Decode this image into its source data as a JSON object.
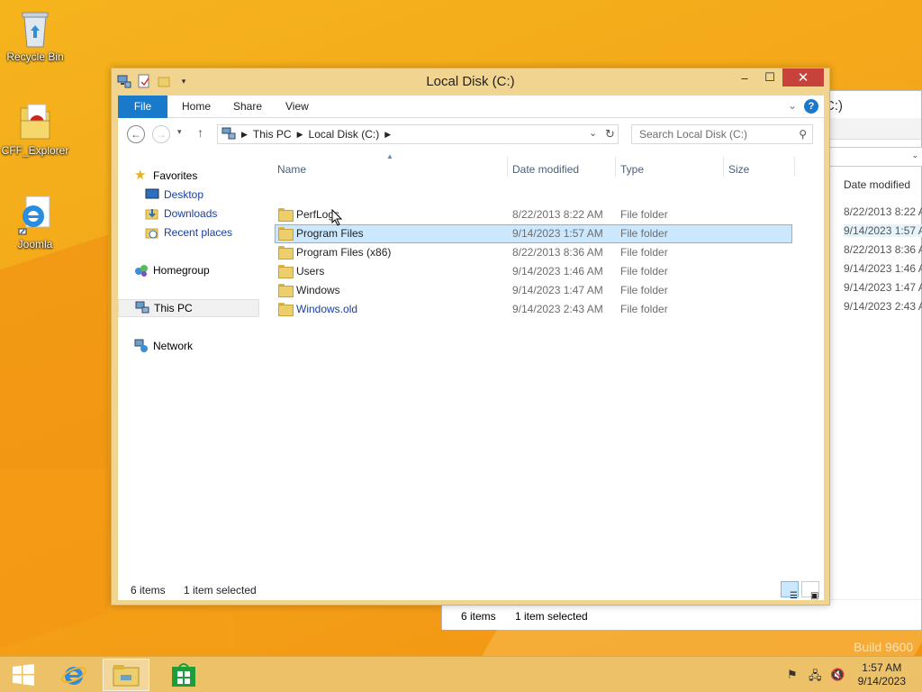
{
  "desktop": {
    "icons": [
      {
        "label": "Recycle Bin",
        "icon": "recycle-bin-icon"
      },
      {
        "label": "CFF_Explorer",
        "icon": "cff-explorer-icon"
      },
      {
        "label": "Joomla",
        "icon": "internet-explorer-icon"
      }
    ],
    "watermark": "Build 9600"
  },
  "background_window": {
    "title_fragment": "C:)",
    "column_header": "Date modified",
    "rows": [
      "8/22/2013 8:22 A",
      "9/14/2023 1:57 A",
      "8/22/2013 8:36 A",
      "9/14/2023 1:46 A",
      "9/14/2023 1:47 A",
      "9/14/2023 2:43 A"
    ],
    "status_count": "6 items",
    "status_selected": "1 item selected"
  },
  "window": {
    "title": "Local Disk (C:)",
    "controls": {
      "minimize": "–",
      "maximize": "☐",
      "close": "✕"
    },
    "ribbon_tabs": {
      "file": "File",
      "home": "Home",
      "share": "Share",
      "view": "View"
    },
    "help": "?",
    "address": {
      "crumb1": "This PC",
      "crumb2": "Local Disk (C:)"
    },
    "search_placeholder": "Search Local Disk (C:)",
    "nav_pane": {
      "favorites": "Favorites",
      "desktop": "Desktop",
      "downloads": "Downloads",
      "recent": "Recent places",
      "homegroup": "Homegroup",
      "this_pc": "This PC",
      "network": "Network"
    },
    "columns": {
      "name": "Name",
      "date": "Date modified",
      "type": "Type",
      "size": "Size"
    },
    "files": [
      {
        "name": "PerfLogs",
        "date": "8/22/2013 8:22 AM",
        "type": "File folder"
      },
      {
        "name": "Program Files",
        "date": "9/14/2023 1:57 AM",
        "type": "File folder",
        "selected": true
      },
      {
        "name": "Program Files (x86)",
        "date": "8/22/2013 8:36 AM",
        "type": "File folder"
      },
      {
        "name": "Users",
        "date": "9/14/2023 1:46 AM",
        "type": "File folder"
      },
      {
        "name": "Windows",
        "date": "9/14/2023 1:47 AM",
        "type": "File folder"
      },
      {
        "name": "Windows.old",
        "date": "9/14/2023 2:43 AM",
        "type": "File folder"
      }
    ],
    "status": {
      "count": "6 items",
      "selected": "1 item selected"
    }
  },
  "taskbar": {
    "time": "1:57 AM",
    "date": "9/14/2023"
  },
  "colors": {
    "accent": "#1979ca",
    "selection": "#cce8ff",
    "window_frame": "#f2d491",
    "close": "#c7423a"
  }
}
